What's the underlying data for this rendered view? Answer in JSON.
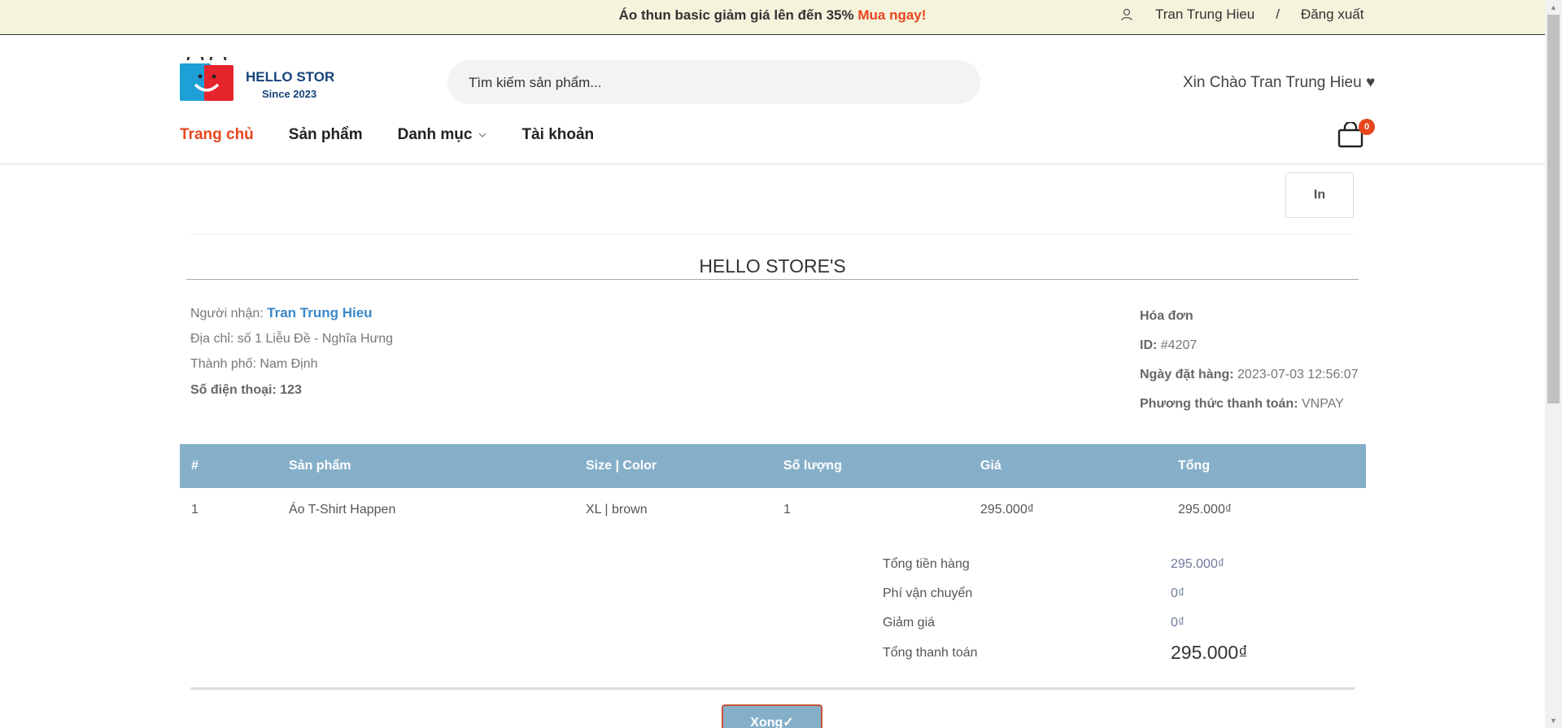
{
  "topbar": {
    "promo_text": "Áo thun basic giảm giá lên đến 35%",
    "promo_link": "Mua ngay!",
    "username": "Tran Trung Hieu",
    "separator": "/",
    "logout": "Đăng xuất"
  },
  "header": {
    "logo_line1": "HELLO STORE",
    "logo_line2": "Since 2023",
    "search_placeholder": "Tìm kiếm sản phẩm...",
    "greeting": "Xin Chào Tran Trung Hieu ♥",
    "cart_count": "0"
  },
  "nav": {
    "items": [
      {
        "label": "Trang chủ"
      },
      {
        "label": "Sản phẩm"
      },
      {
        "label": "Danh mục"
      },
      {
        "label": "Tài khoản"
      }
    ]
  },
  "invoice": {
    "print_label": "In",
    "store_title": "HELLO STORE'S",
    "recipient_label": "Người nhận:",
    "recipient_name": "Tran Trung Hieu",
    "address": "Địa chỉ: số 1 Liễu Đề - Nghĩa Hưng",
    "city": "Thành phố: Nam Định",
    "phone": "Số điện thoại: 123",
    "invoice_label": "Hóa đơn",
    "id_label": "ID:",
    "id_value": "#4207",
    "date_label": "Ngày đặt hàng:",
    "date_value": "2023-07-03 12:56:07",
    "payment_label": "Phương thức thanh toán:",
    "payment_value": "VNPAY"
  },
  "table": {
    "headers": [
      "#",
      "Sản phẩm",
      "Size | Color",
      "Số lượng",
      "Giá",
      "Tổng"
    ],
    "rows": [
      [
        "1",
        "Áo T-Shirt Happen",
        "XL | brown",
        "1",
        "295.000₫",
        "295.000₫"
      ]
    ]
  },
  "summary": {
    "subtotal_label": "Tổng tiền hàng",
    "subtotal_value": "295.000₫",
    "shipping_label": "Phí vận chuyển",
    "shipping_value": "0₫",
    "discount_label": "Giảm giá",
    "discount_value": "0₫",
    "total_label": "Tổng thanh toán",
    "total_value": "295.000₫"
  },
  "done_button": "Xong✓",
  "colors": {
    "accent": "#e8451e",
    "table_header": "#85afc9",
    "topbar_bg": "#f5f3dc",
    "link_blue": "#3a87c8"
  }
}
